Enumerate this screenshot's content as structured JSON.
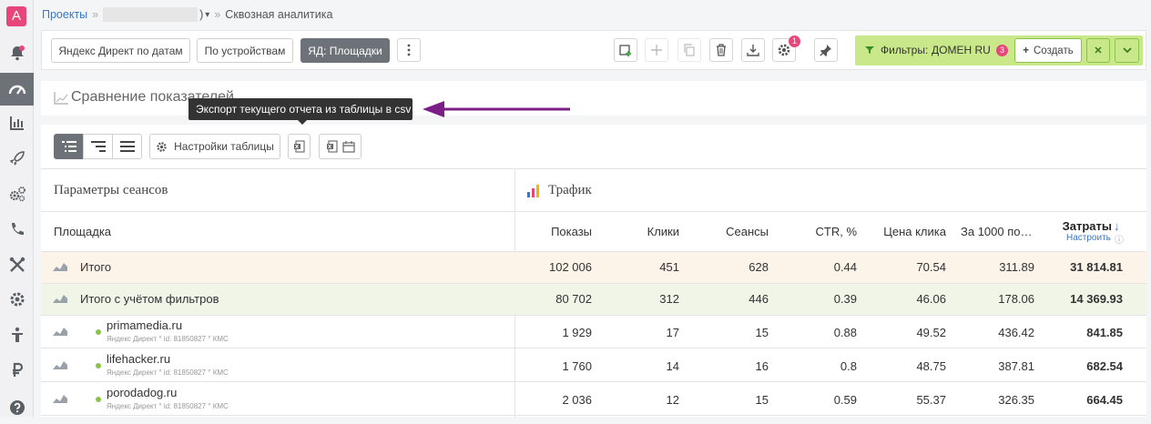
{
  "breadcrumb": {
    "projects": "Проекты",
    "project_suffix": ")",
    "page": "Сквозная аналитика"
  },
  "toolbar": {
    "buttons": [
      "Яндекс Директ по датам",
      "По устройствам",
      "ЯД: Площадки"
    ],
    "settings_badge": "1",
    "filter_label": "Фильтры:",
    "filter_value": "ДОМЕН RU",
    "filter_count": "3",
    "create_label": "Создать"
  },
  "section": {
    "title": "Сравнение показателей"
  },
  "tooltip": "Экспорт текущего отчета из таблицы в csv",
  "table_toolbar": {
    "settings_label": "Настройки таблицы"
  },
  "table": {
    "group_left": "Параметры сеансов",
    "group_right": "Трафик",
    "col_first": "Площадка",
    "columns": [
      "Показы",
      "Клики",
      "Сеансы",
      "CTR, %",
      "Цена клика",
      "За 1000 по…",
      "Затраты"
    ],
    "configure": "Настроить",
    "rows": [
      {
        "name": "Итого",
        "values": [
          "102 006",
          "451",
          "628",
          "0.44",
          "70.54",
          "311.89",
          "31 814.81"
        ]
      },
      {
        "name": "Итого с учётом фильтров",
        "values": [
          "80 702",
          "312",
          "446",
          "0.39",
          "46.06",
          "178.06",
          "14 369.93"
        ]
      },
      {
        "name": "primamedia.ru",
        "meta": "Яндекс Директ  °  id: 81850827  °  КМС",
        "values": [
          "1 929",
          "17",
          "15",
          "0.88",
          "49.52",
          "436.42",
          "841.85"
        ]
      },
      {
        "name": "lifehacker.ru",
        "meta": "Яндекс Директ  °  id: 81850827  °  КМС",
        "values": [
          "1 760",
          "14",
          "16",
          "0.8",
          "48.75",
          "387.81",
          "682.54"
        ]
      },
      {
        "name": "porodadog.ru",
        "meta": "Яндекс Директ  °  id: 81850827  °  КМС",
        "values": [
          "2 036",
          "12",
          "15",
          "0.59",
          "55.37",
          "326.35",
          "664.45"
        ]
      }
    ]
  },
  "colors": {
    "accent": "#e8457b",
    "filter_bg": "#c9e889",
    "arrow": "#7b1f86",
    "link": "#3a78c2"
  }
}
